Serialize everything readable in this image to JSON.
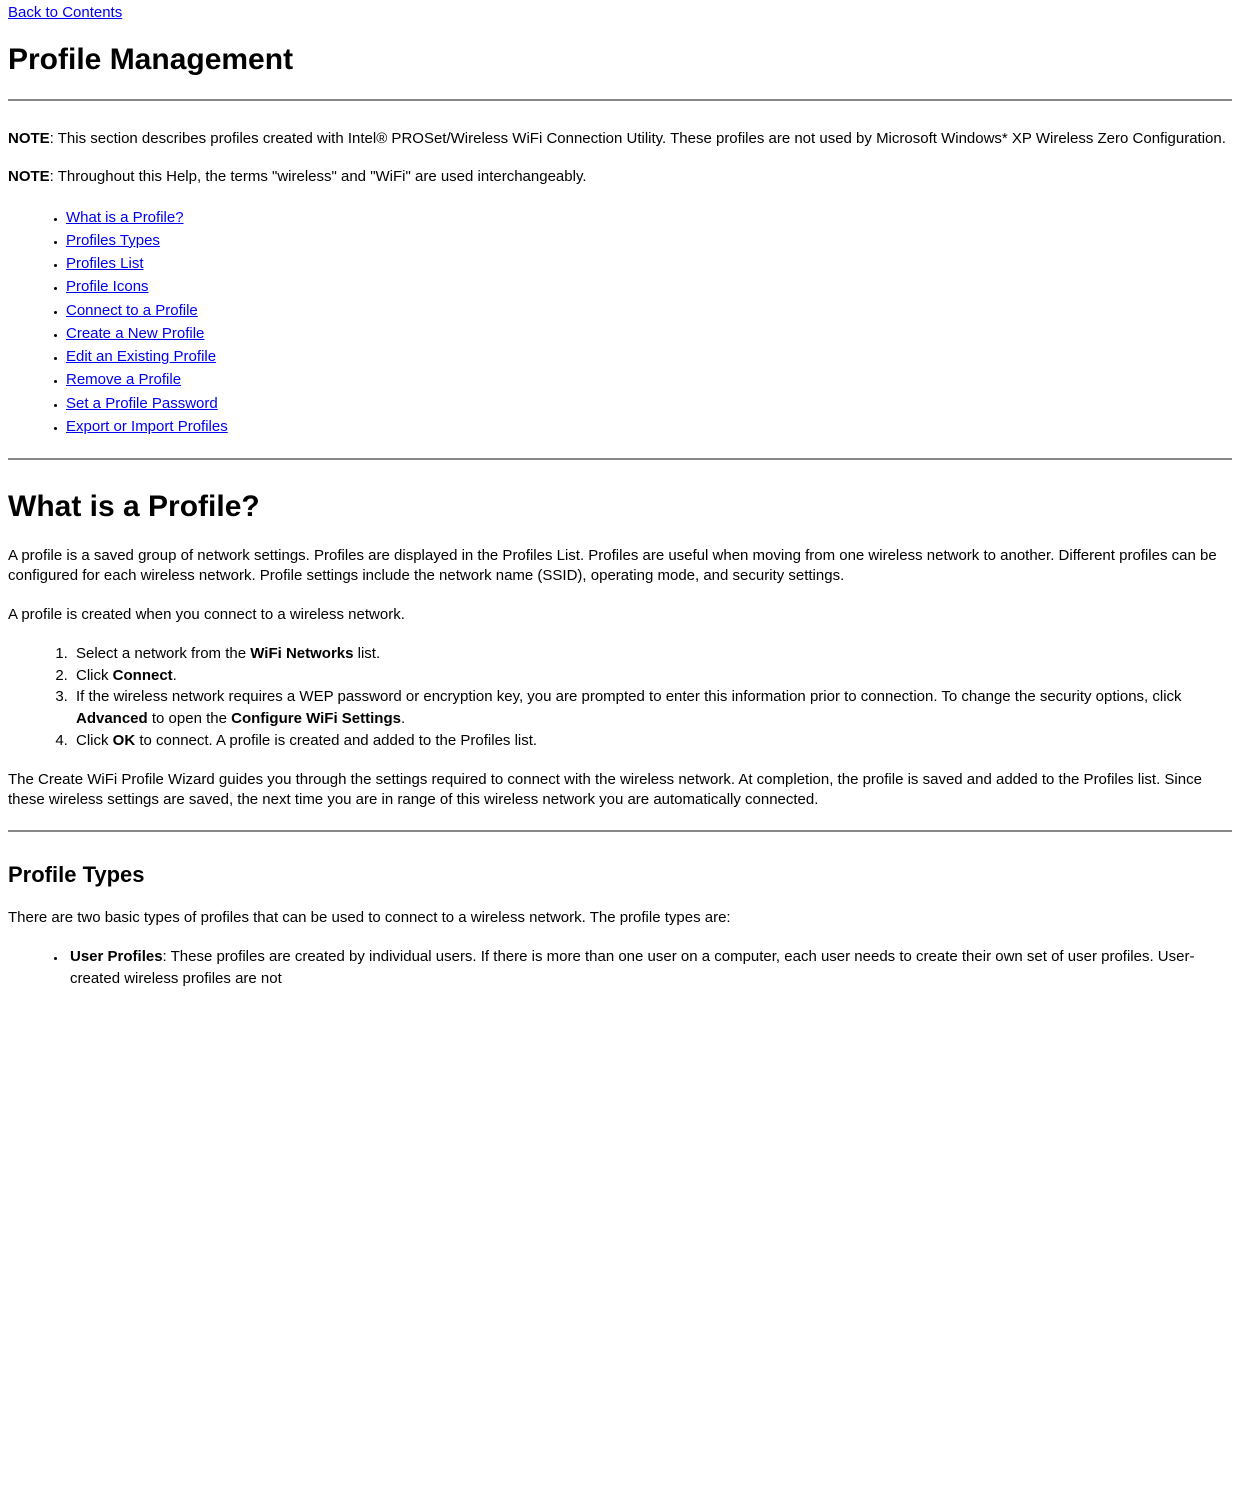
{
  "back_link": "Back to Contents",
  "title": "Profile Management",
  "note1_label": "NOTE",
  "note1_text": ": This section describes profiles created with Intel® PROSet/Wireless WiFi Connection Utility. These profiles are not used by Microsoft Windows* XP Wireless Zero Configuration.",
  "note2_label": "NOTE",
  "note2_text": ": Throughout this Help, the terms \"wireless\" and \"WiFi\" are used interchangeably.",
  "toc": [
    "What is a Profile?",
    "Profiles Types",
    "Profiles List",
    "Profile Icons",
    "Connect to a Profile",
    "Create a New Profile",
    "Edit an Existing Profile",
    "Remove a Profile",
    "Set a Profile Password",
    "Export or Import Profiles"
  ],
  "h_what": "What is a Profile?",
  "p_what1": "A profile is a saved group of network settings. Profiles are displayed in the Profiles List. Profiles are useful when moving from one wireless network to another. Different profiles can be configured for each wireless network. Profile settings include the network name (SSID), operating mode, and security settings.",
  "p_what2": "A profile is created when you connect to a wireless network.",
  "steps": {
    "s1a": "Select a network from the ",
    "s1b": "WiFi Networks",
    "s1c": " list.",
    "s2a": "Click ",
    "s2b": "Connect",
    "s2c": ".",
    "s3a": "If the wireless network requires a WEP password or encryption key, you are prompted to enter this information prior to connection. To change the security options, click ",
    "s3b": "Advanced",
    "s3c": " to open the ",
    "s3d": "Configure WiFi Settings",
    "s3e": ".",
    "s4a": "Click ",
    "s4b": "OK",
    "s4c": " to connect. A profile is created and added to the Profiles list."
  },
  "p_what3": "The Create WiFi Profile Wizard guides you through the settings required to connect with the wireless network. At completion, the profile is saved and added to the Profiles list. Since these wireless settings are saved, the next time you are in range of this wireless network you are automatically connected.",
  "h_types": "Profile Types",
  "p_types1": "There are two basic types of profiles that can be used to connect to a wireless network. The profile types are:",
  "user_profiles_label": "User Profiles",
  "user_profiles_text": ": These profiles are created by individual users. If there is more than one user on a computer, each user needs to create their own set of user profiles. User-created wireless profiles are not"
}
